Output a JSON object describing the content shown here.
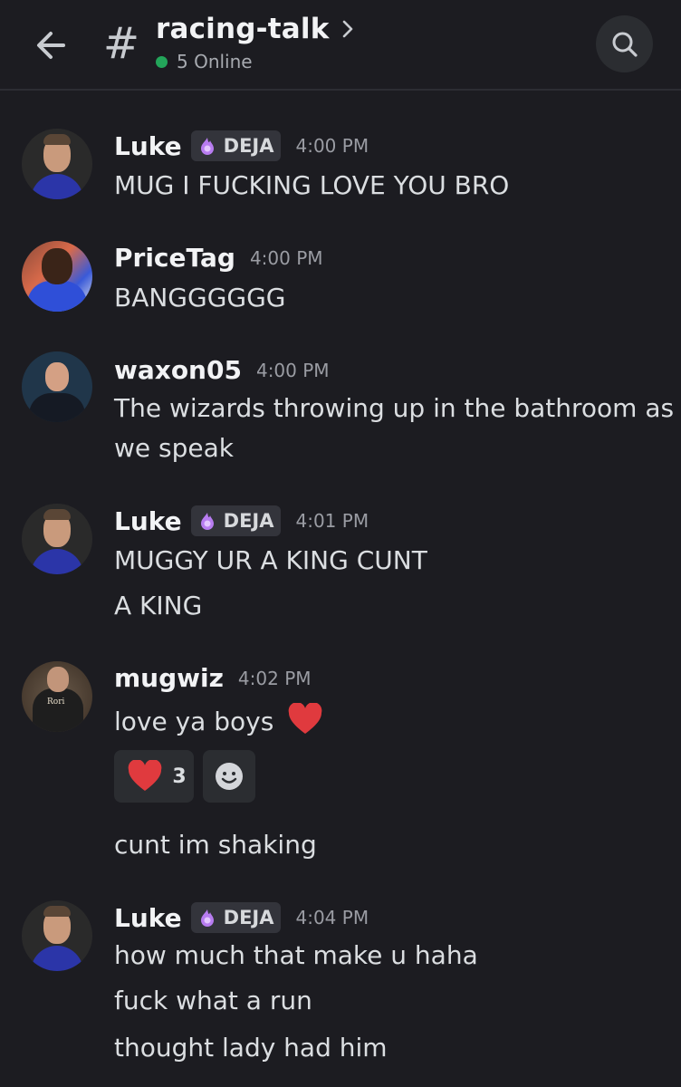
{
  "header": {
    "channel_name": "racing-talk",
    "online_text": "5 Online",
    "hash_symbol": "#"
  },
  "messages": [
    {
      "author": "Luke",
      "badge": "DEJA",
      "time": "4:00 PM",
      "lines": [
        "MUG I FUCKING LOVE YOU BRO"
      ]
    },
    {
      "author": "PriceTag",
      "time": "4:00 PM",
      "lines": [
        "BANGGGGGG"
      ]
    },
    {
      "author": "waxon05",
      "time": "4:00 PM",
      "lines": [
        "The wizards throwing up in the bathroom as",
        "we speak"
      ]
    },
    {
      "author": "Luke",
      "badge": "DEJA",
      "time": "4:01 PM",
      "lines": [
        "MUGGY UR A KING CUNT",
        "A KING"
      ]
    },
    {
      "author": "mugwiz",
      "time": "4:02 PM",
      "lines": [
        "love ya boys",
        "cunt im shaking"
      ],
      "avatar_shirt_text": "Rori",
      "reactions": [
        {
          "emoji": "heart",
          "count": "3"
        },
        {
          "emoji": "add-reaction"
        }
      ]
    },
    {
      "author": "Luke",
      "badge": "DEJA",
      "time": "4:04 PM",
      "lines": [
        "how much that make u haha",
        "fuck what a run",
        "thought lady had him"
      ]
    }
  ],
  "colors": {
    "background": "#1c1c21",
    "online_dot": "#23a55a",
    "heart": "#e03a3e",
    "badge_icon": "#b77cf0"
  }
}
